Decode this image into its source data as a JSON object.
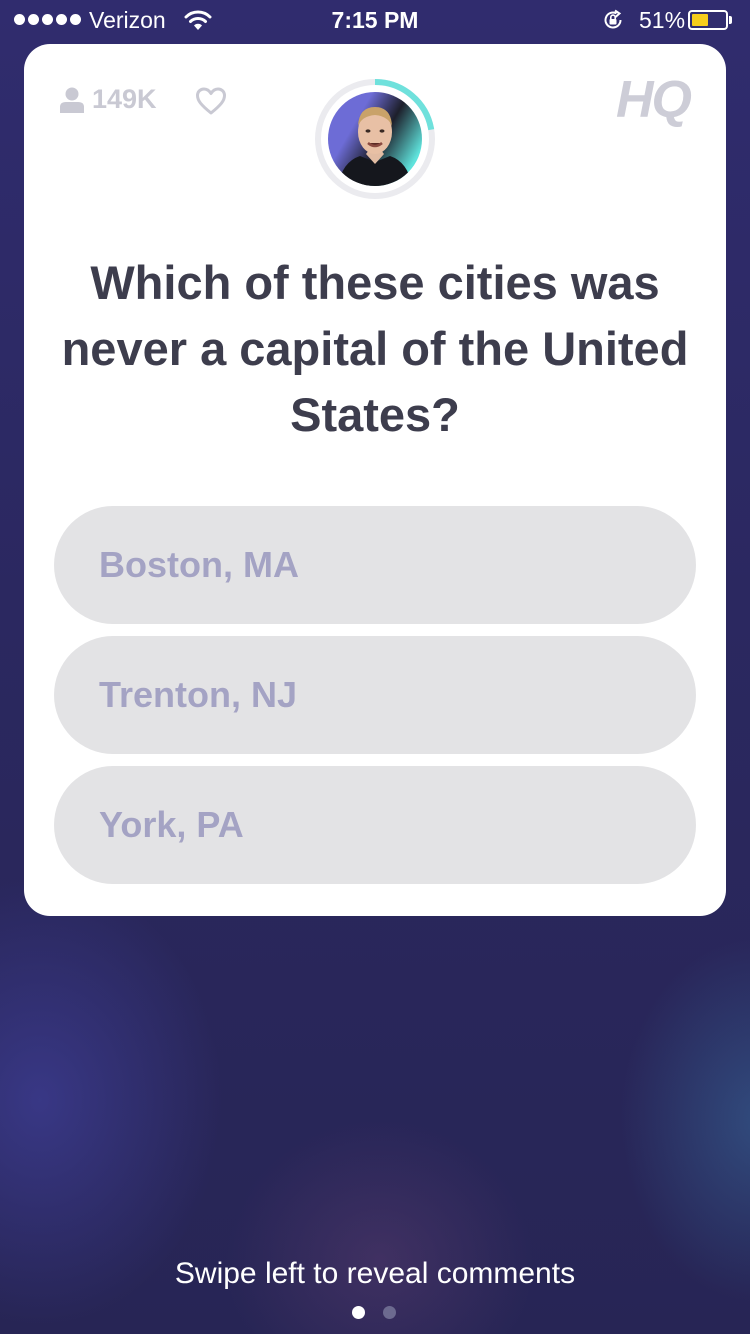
{
  "status_bar": {
    "carrier": "Verizon",
    "time": "7:15 PM",
    "battery_percent": "51%",
    "battery_level": 0.51,
    "battery_color": "#f7cd1a"
  },
  "card": {
    "viewer_count": "149K",
    "logo": "HQ",
    "question": "Which of these cities was never a capital of the United States?",
    "answers": [
      {
        "label": "Boston, MA"
      },
      {
        "label": "Trenton, NJ"
      },
      {
        "label": "York, PA"
      }
    ],
    "icons": {
      "viewers": "user-icon",
      "like": "heart-icon",
      "host": "host-avatar"
    },
    "timer_ring_color": "#6fe1dc"
  },
  "footer": {
    "hint": "Swipe left to reveal comments",
    "pages": 2,
    "active_page": 1
  }
}
